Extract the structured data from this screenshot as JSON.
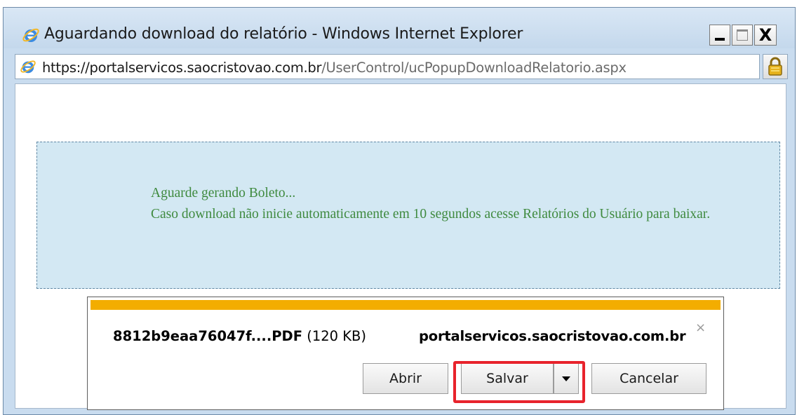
{
  "window": {
    "title": "Aguardando download do relatório - Windows Internet Explorer",
    "min_icon": "minimize-icon",
    "max_icon": "maximize-icon",
    "close_label": "X"
  },
  "address": {
    "url_prefix": "https://",
    "url_domain": "portalservicos.saocristovao.com.br",
    "url_path": "/UserControl/ucPopupDownloadRelatorio.aspx"
  },
  "message": {
    "line1": "Aguarde gerando Boleto...",
    "line2": "Caso download não inicie automaticamente em 10 segundos acesse Relatórios do Usuário para baixar."
  },
  "download": {
    "filename": "8812b9eaa76047f....PDF",
    "size": "(120 KB)",
    "site": "portalservicos.saocristovao.com.br",
    "close_label": "×",
    "open_label": "Abrir",
    "save_label": "Salvar",
    "cancel_label": "Cancelar"
  },
  "colors": {
    "notification_bar": "#f3ad00",
    "highlight": "#e8232c",
    "message_text": "#3f8a3f",
    "message_bg": "#d3e8f3"
  }
}
